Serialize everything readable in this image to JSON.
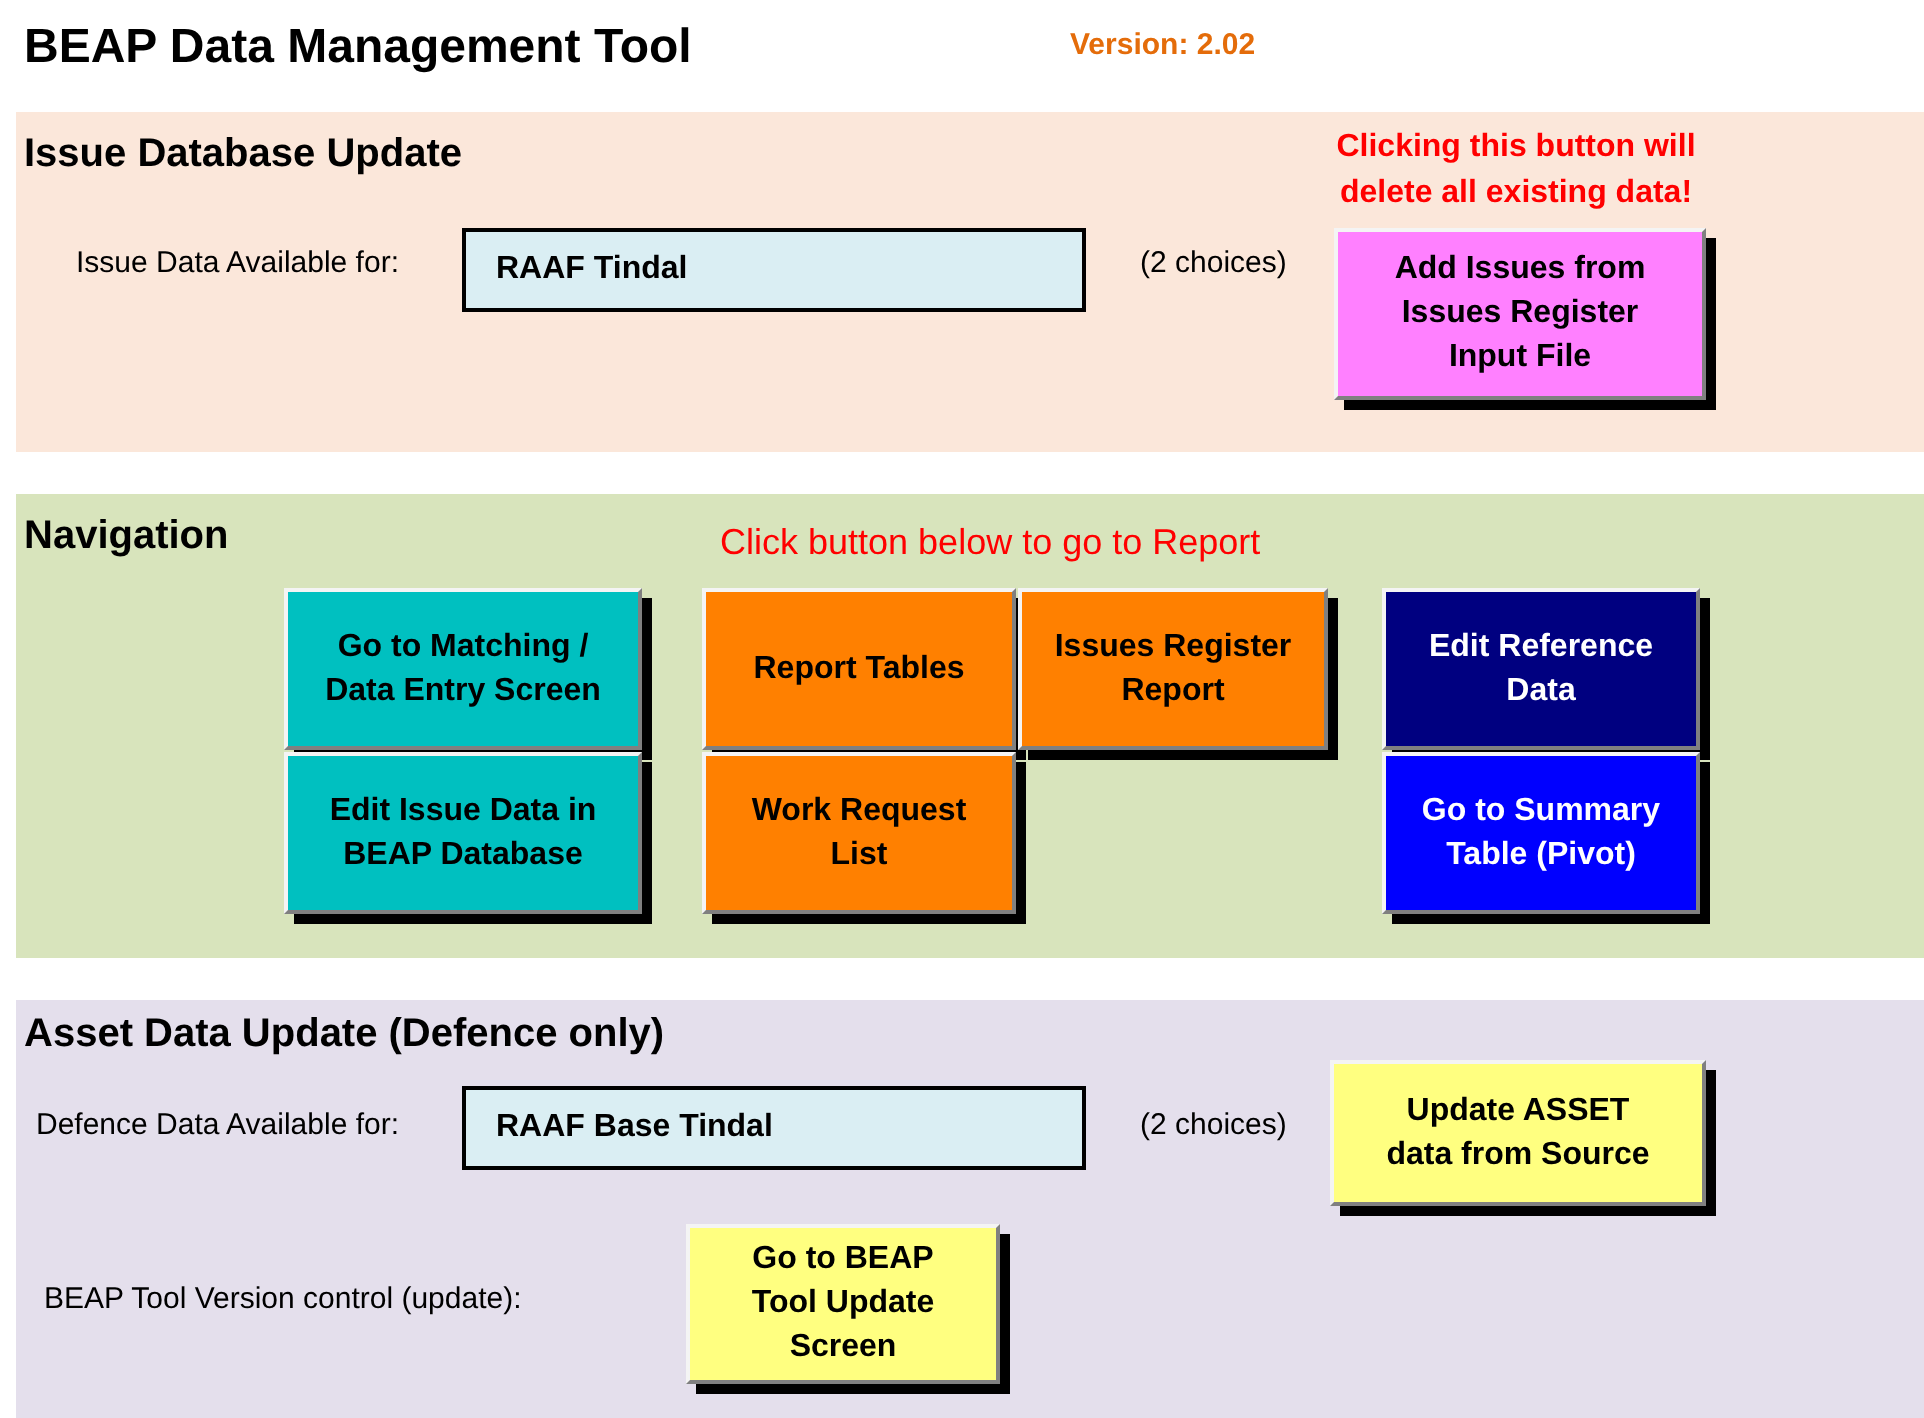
{
  "title": "BEAP Data Management Tool",
  "version": "Version: 2.02",
  "issue_update": {
    "heading": "Issue Database Update",
    "warning": "Clicking this button will delete all existing data!",
    "label": "Issue Data Available for:",
    "value": "RAAF Tindal",
    "choices": "(2 choices)",
    "button": {
      "label": "Add Issues from Issues Register Input File",
      "color": "#ff80ff"
    }
  },
  "navigation": {
    "heading": "Navigation",
    "hint": "Click button below to go to Report",
    "buttons": [
      {
        "label": "Go to Matching / Data Entry Screen",
        "color": "#00c0c0"
      },
      {
        "label": "Edit Issue Data in BEAP Database",
        "color": "#00c0c0"
      },
      {
        "label": "Report Tables",
        "color": "#ff8000"
      },
      {
        "label": "Issues Register Report",
        "color": "#ff8000"
      },
      {
        "label": "Work Request List",
        "color": "#ff8000"
      },
      {
        "label": "Edit Reference Data",
        "color": "#000080"
      },
      {
        "label": "Go to Summary Table (Pivot)",
        "color": "#0000ff"
      }
    ]
  },
  "asset_update": {
    "heading": "Asset Data Update (Defence only)",
    "label": "Defence Data Available for:",
    "value": "RAAF Base Tindal",
    "choices": "(2 choices)",
    "button": {
      "label": "Update ASSET data from Source",
      "color": "#ffff80"
    },
    "version_label": "BEAP Tool Version control (update):",
    "version_button": {
      "label": "Go to BEAP Tool Update Screen",
      "color": "#ffff80"
    }
  }
}
